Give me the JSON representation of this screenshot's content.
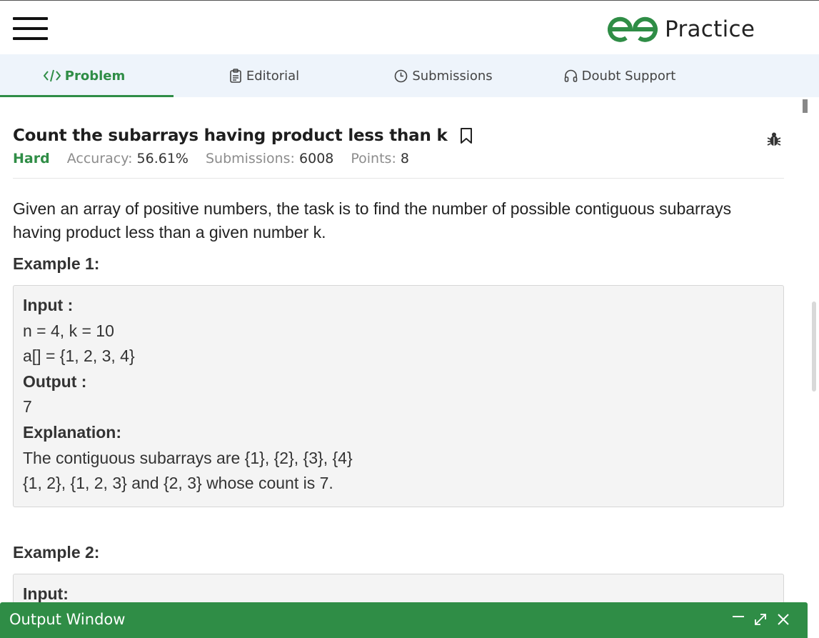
{
  "header": {
    "brand_text": "Practice",
    "brand_color": "#2f8d46"
  },
  "tabs": [
    {
      "label": "Problem",
      "icon": "code-icon",
      "active": true
    },
    {
      "label": "Editorial",
      "icon": "document-icon",
      "active": false
    },
    {
      "label": "Submissions",
      "icon": "clock-icon",
      "active": false
    },
    {
      "label": "Doubt Support",
      "icon": "headset-icon",
      "active": false
    }
  ],
  "problem": {
    "title": "Count the subarrays having product less than k",
    "difficulty": "Hard",
    "accuracy_label": "Accuracy:",
    "accuracy": "56.61%",
    "submissions_label": "Submissions:",
    "submissions": "6008",
    "points_label": "Points:",
    "points": "8",
    "description": "Given an array of positive numbers, the task is to find the number of possible contiguous subarrays having product less than a given number k."
  },
  "examples": [
    {
      "title": "Example 1:",
      "lines": [
        {
          "text": "Input :",
          "bold": true
        },
        {
          "text": "n = 4, k = 10",
          "bold": false
        },
        {
          "text": "a[] = {1, 2, 3, 4}",
          "bold": false
        },
        {
          "text": "Output :",
          "bold": true
        },
        {
          "text": "7",
          "bold": false
        },
        {
          "text": "Explanation:",
          "bold": true
        },
        {
          "text": "The contiguous subarrays are {1}, {2}, {3}, {4}",
          "bold": false
        },
        {
          "text": "{1, 2}, {1, 2, 3} and {2, 3} whose count is 7.",
          "bold": false
        }
      ]
    },
    {
      "title": "Example 2:",
      "lines": [
        {
          "text": "Input:",
          "bold": true
        }
      ]
    }
  ],
  "output_window": {
    "title": "Output Window"
  },
  "colors": {
    "accent": "#2f8d46",
    "tab_bar_bg": "#eef4fb",
    "example_bg": "#f4f4f4"
  }
}
